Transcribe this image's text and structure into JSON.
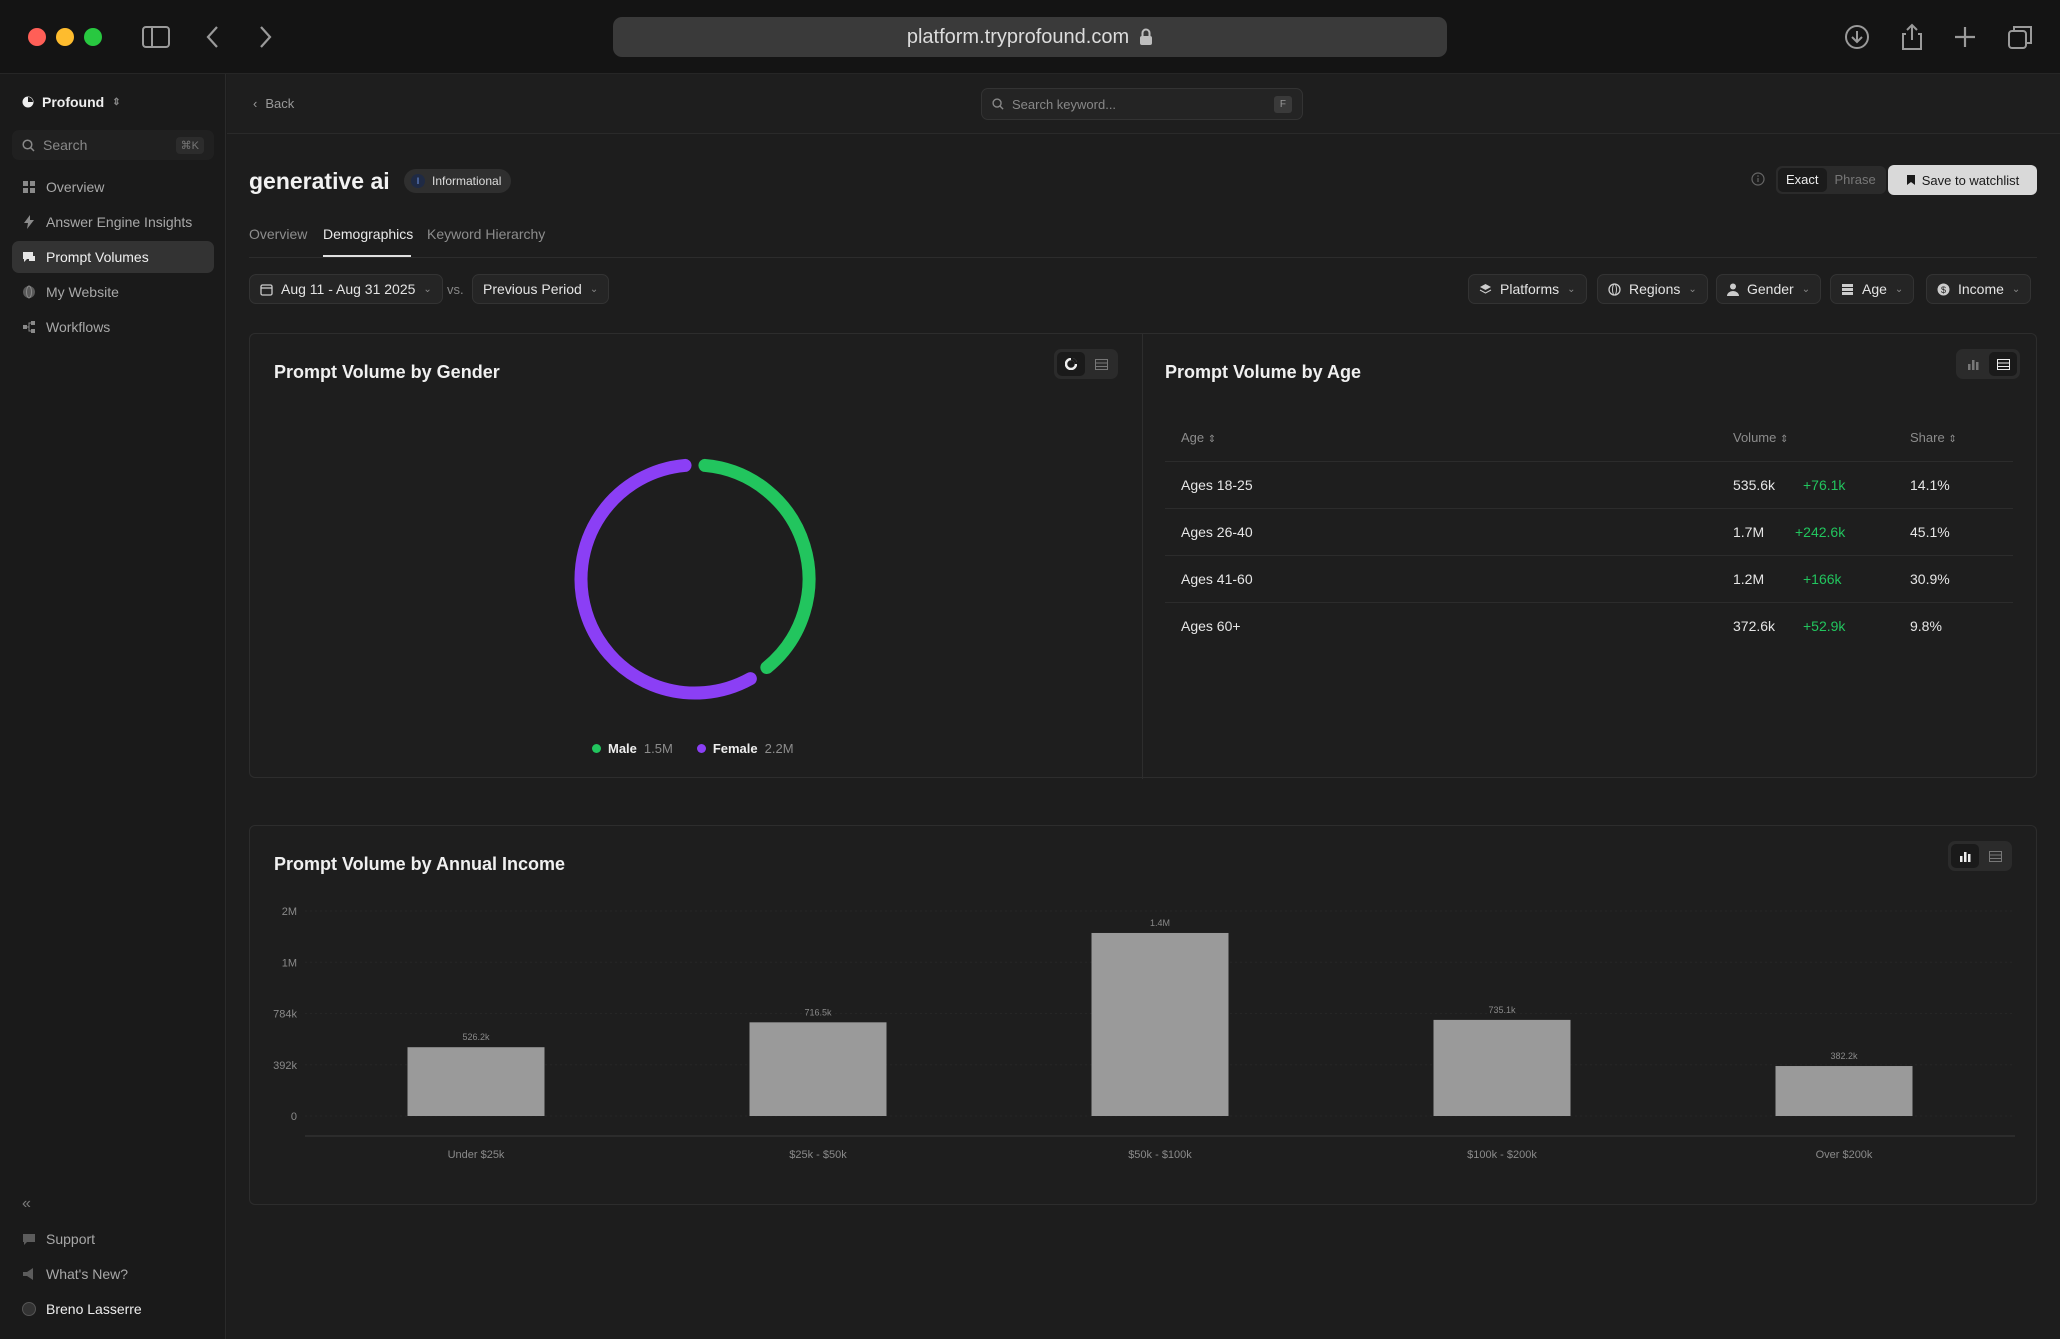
{
  "browser": {
    "url": "platform.tryprofound.com",
    "icons": [
      "sidebar-toggle-icon",
      "back-arrow-icon",
      "forward-arrow-icon",
      "lock-icon",
      "download-icon",
      "share-icon",
      "plus-icon",
      "tabs-icon"
    ]
  },
  "sidebar": {
    "workspace": "Profound",
    "search_placeholder": "Search",
    "search_shortcut": "⌘K",
    "items": [
      {
        "label": "Overview",
        "icon": "grid-icon"
      },
      {
        "label": "Answer Engine Insights",
        "icon": "bolt-icon"
      },
      {
        "label": "Prompt Volumes",
        "icon": "chat-icon",
        "active": true
      },
      {
        "label": "My Website",
        "icon": "globe-icon"
      },
      {
        "label": "Workflows",
        "icon": "workflow-icon"
      }
    ],
    "collapse": "«",
    "footer": [
      {
        "label": "Support",
        "icon": "support-icon"
      },
      {
        "label": "What's New?",
        "icon": "megaphone-icon"
      }
    ],
    "user": "Breno Lasserre"
  },
  "topbar": {
    "back": "Back",
    "search_placeholder": "Search keyword...",
    "search_shortcut": "F"
  },
  "header": {
    "title": "generative ai",
    "badge_letter": "I",
    "badge": "Informational",
    "match_exact": "Exact",
    "match_phrase": "Phrase",
    "save": "Save to watchlist"
  },
  "tabs": [
    "Overview",
    "Demographics",
    "Keyword Hierarchy"
  ],
  "active_tab": "Demographics",
  "filters": {
    "date_range": "Aug 11 - Aug 31 2025",
    "vs": "vs.",
    "comparison": "Previous Period",
    "dropdowns": [
      "Platforms",
      "Regions",
      "Gender",
      "Age",
      "Income"
    ]
  },
  "gender_card": {
    "title": "Prompt Volume by Gender",
    "legend": [
      {
        "label": "Male",
        "value": "1.5M",
        "color": "#22c55e"
      },
      {
        "label": "Female",
        "value": "2.2M",
        "color": "#8b3ff5"
      }
    ]
  },
  "age_card": {
    "title": "Prompt Volume by Age",
    "columns": [
      "Age",
      "Volume",
      "Share"
    ],
    "rows": [
      {
        "age": "Ages 18-25",
        "volume": "535.6k",
        "change": "+76.1k",
        "share": "14.1%"
      },
      {
        "age": "Ages 26-40",
        "volume": "1.7M",
        "change": "+242.6k",
        "share": "45.1%"
      },
      {
        "age": "Ages 41-60",
        "volume": "1.2M",
        "change": "+166k",
        "share": "30.9%"
      },
      {
        "age": "Ages 60+",
        "volume": "372.6k",
        "change": "+52.9k",
        "share": "9.8%"
      }
    ]
  },
  "income_card": {
    "title": "Prompt Volume by Annual Income"
  },
  "chart_data": [
    {
      "type": "pie",
      "title": "Prompt Volume by Gender",
      "categories": [
        "Male",
        "Female"
      ],
      "values": [
        1.5,
        2.2
      ],
      "unit": "M",
      "colors": [
        "#22c55e",
        "#8b3ff5"
      ]
    },
    {
      "type": "bar",
      "title": "Prompt Volume by Annual Income",
      "categories": [
        "Under $25k",
        "$25k - $50k",
        "$50k - $100k",
        "$100k - $200k",
        "Over $200k"
      ],
      "values": [
        526200,
        716500,
        1400000,
        735100,
        382200
      ],
      "data_labels": [
        "526.2k",
        "716.5k",
        "1.4M",
        "735.1k",
        "382.2k"
      ],
      "y_ticks": [
        "0",
        "392k",
        "784k",
        "1M",
        "2M"
      ],
      "y_tick_values": [
        0,
        392000,
        784000,
        1176000,
        1568000
      ],
      "ylim": [
        0,
        1568000
      ],
      "bar_color": "#9a9a9a",
      "grid": true
    }
  ]
}
